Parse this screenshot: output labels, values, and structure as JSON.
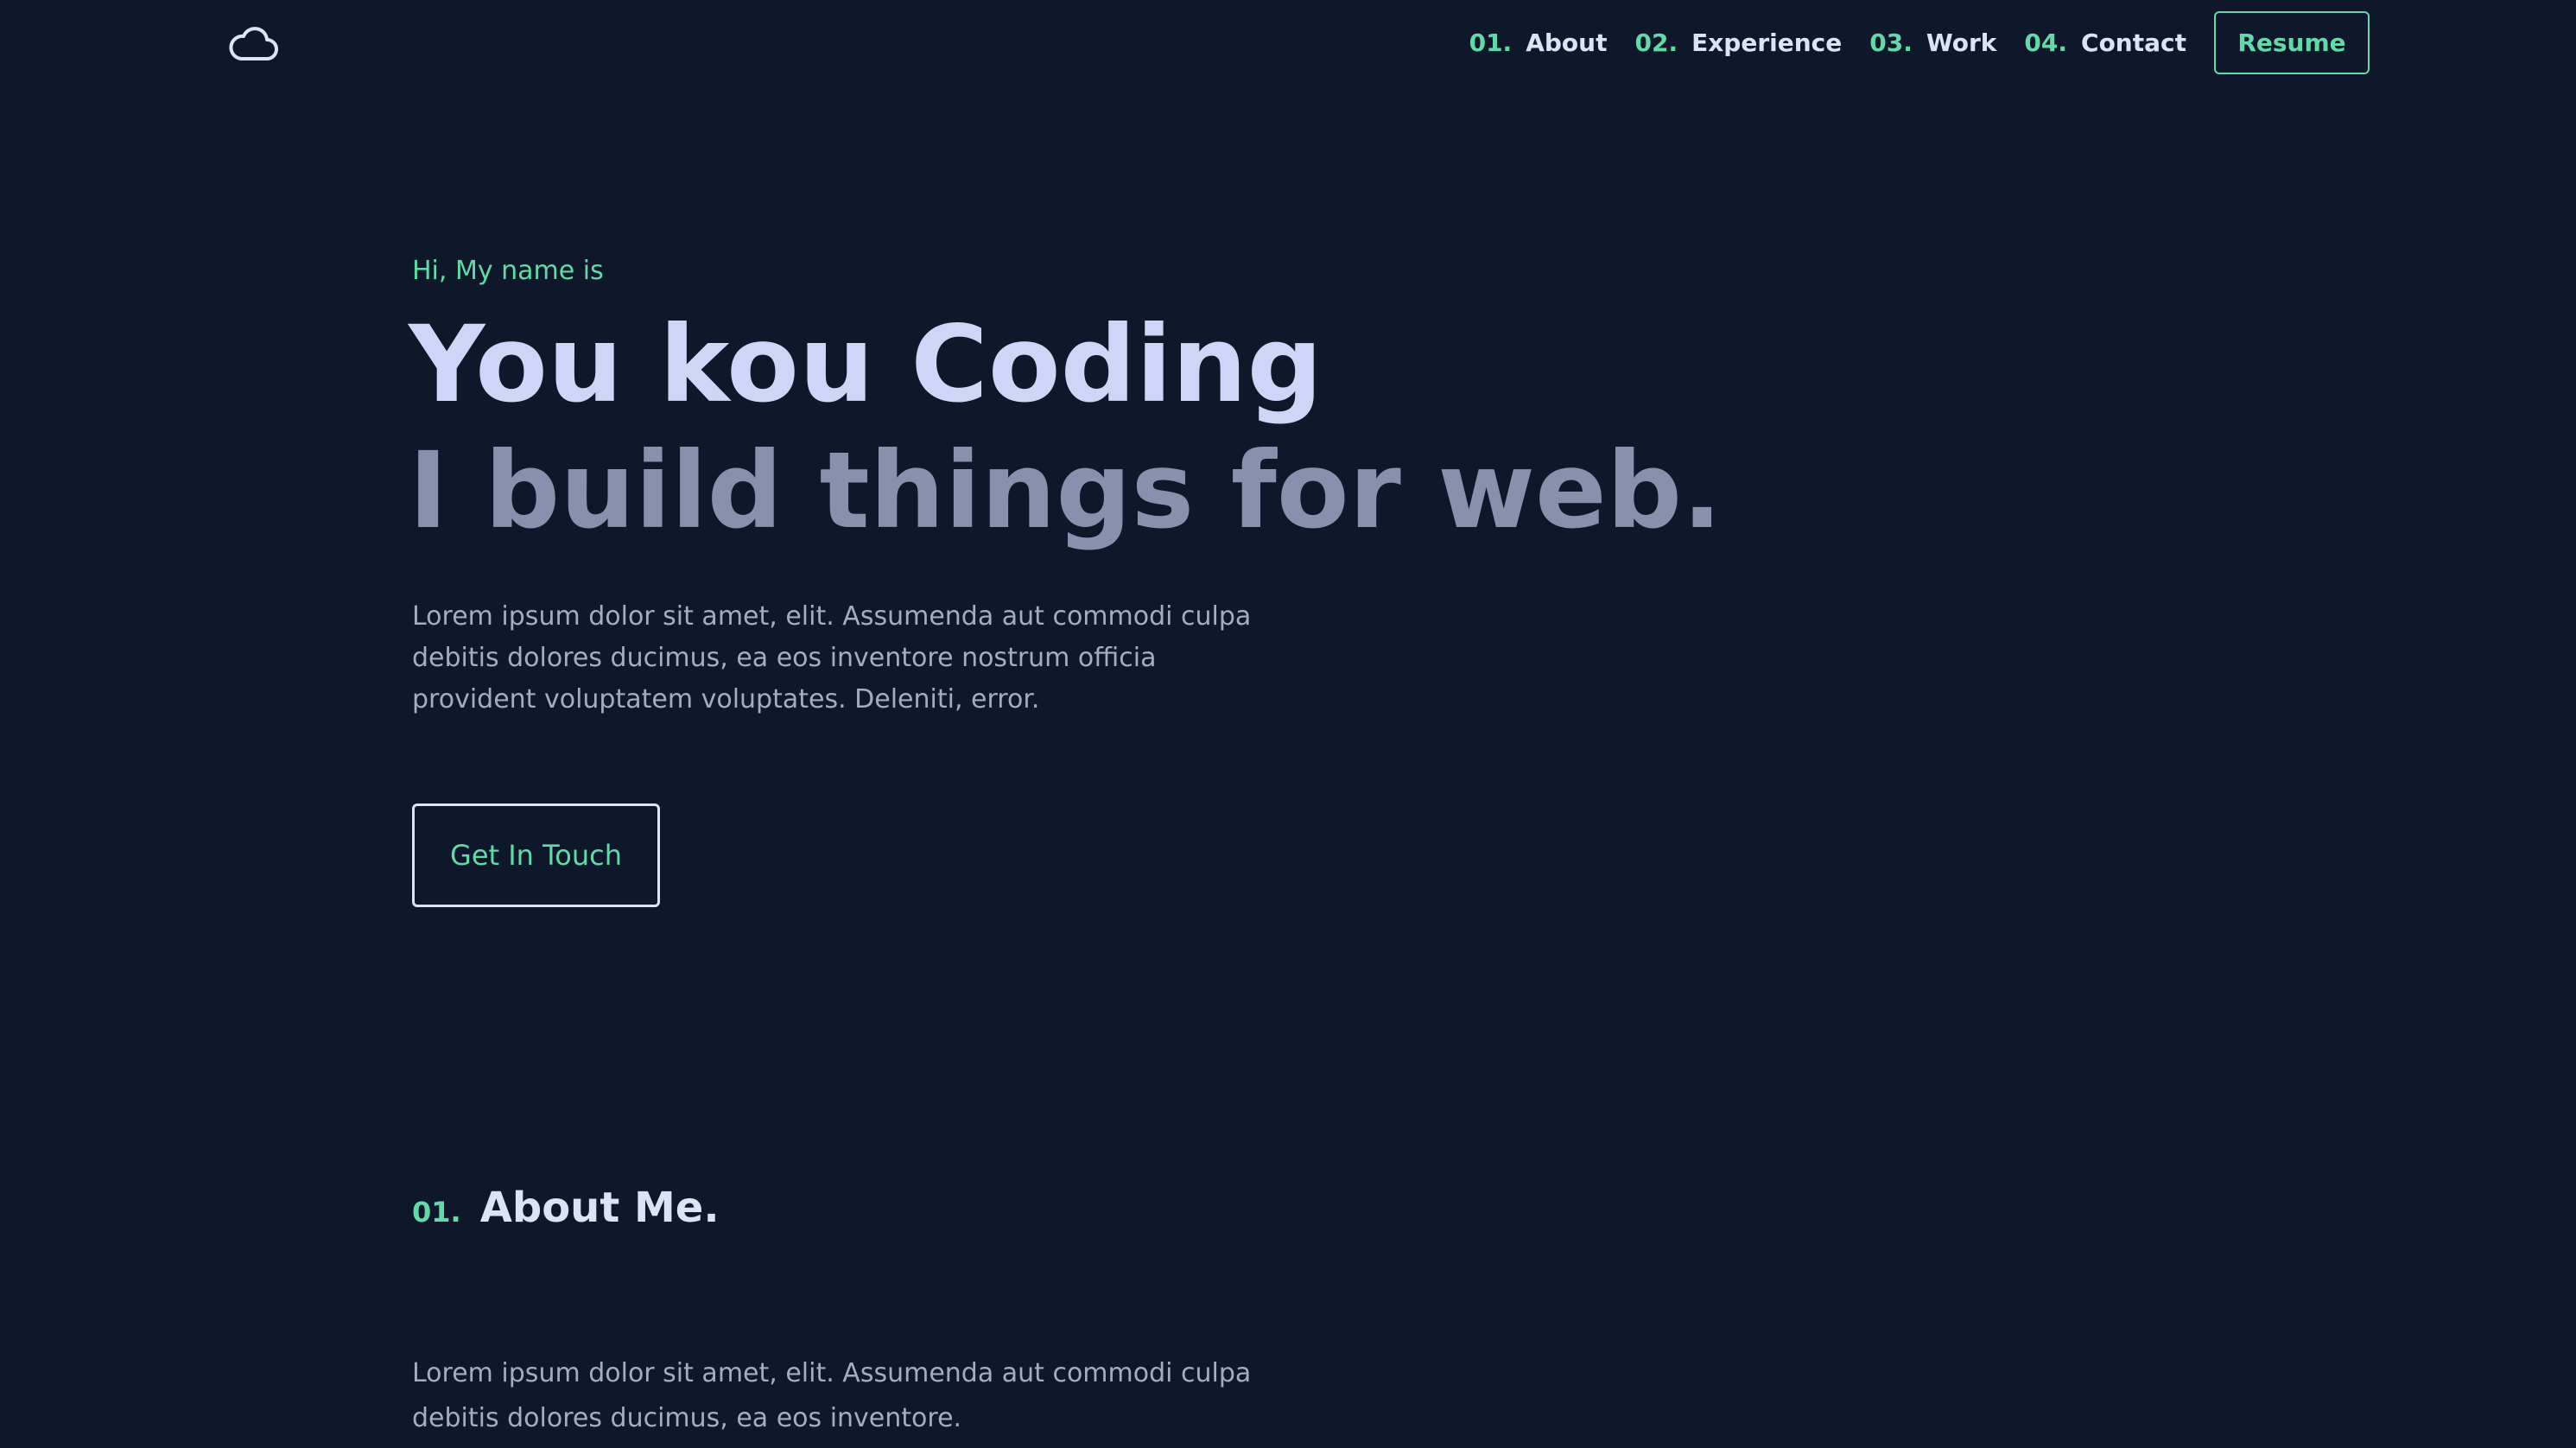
{
  "header": {
    "logo_icon": "cloud-icon",
    "nav": [
      {
        "num": "01.",
        "label": "About"
      },
      {
        "num": "02.",
        "label": "Experience"
      },
      {
        "num": "03.",
        "label": "Work"
      },
      {
        "num": "04.",
        "label": "Contact"
      }
    ],
    "resume_label": "Resume"
  },
  "hero": {
    "greeting": "Hi, My name is",
    "name": "You kou Coding",
    "tagline": "I build things for web.",
    "description": "Lorem ipsum dolor sit amet, elit. Assumenda aut commodi culpa debitis dolores ducimus, ea eos inventore nostrum officia provident voluptatem voluptates. Deleniti, error.",
    "cta_label": "Get In Touch"
  },
  "about": {
    "num": "01.",
    "title": "About Me.",
    "text": "Lorem ipsum dolor sit amet, elit. Assumenda aut commodi culpa debitis dolores ducimus, ea eos inventore."
  },
  "colors": {
    "background": "#0f172a",
    "accent": "#64d8a8",
    "heading": "#cdd6f6",
    "subheading": "#8591ad",
    "body_text": "#a3acc2"
  }
}
